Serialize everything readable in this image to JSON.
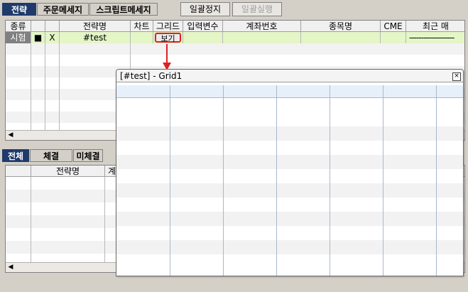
{
  "tabs_top": [
    {
      "label": "전략"
    },
    {
      "label": "주문메세지"
    },
    {
      "label": "스크립트메세지"
    }
  ],
  "toolbar": {
    "stop_all_label": "일괄정지",
    "run_all_label": "일괄실행"
  },
  "strategy_grid": {
    "columns": [
      "종류",
      "",
      "",
      "전략명",
      "차트",
      "그리드",
      "입력변수",
      "계좌번호",
      "종목명",
      "CME",
      "최근 매"
    ],
    "row": {
      "type": "시험",
      "flag": "■",
      "x": "X",
      "name": "#test",
      "grid_button": "보기",
      "recent": "-------------------"
    }
  },
  "tabs_bottom": [
    {
      "label": "전체"
    },
    {
      "label": "체결"
    },
    {
      "label": "미체결"
    }
  ],
  "bottom_grid": {
    "columns": [
      "",
      "전략명",
      "계"
    ]
  },
  "popup": {
    "title": "[#test] - Grid1",
    "close_glyph": "×"
  },
  "colors": {
    "active_tab_bg": "#1f3a6b",
    "row_highlight": "#e4f5c6",
    "annotation_red": "#e02020"
  }
}
